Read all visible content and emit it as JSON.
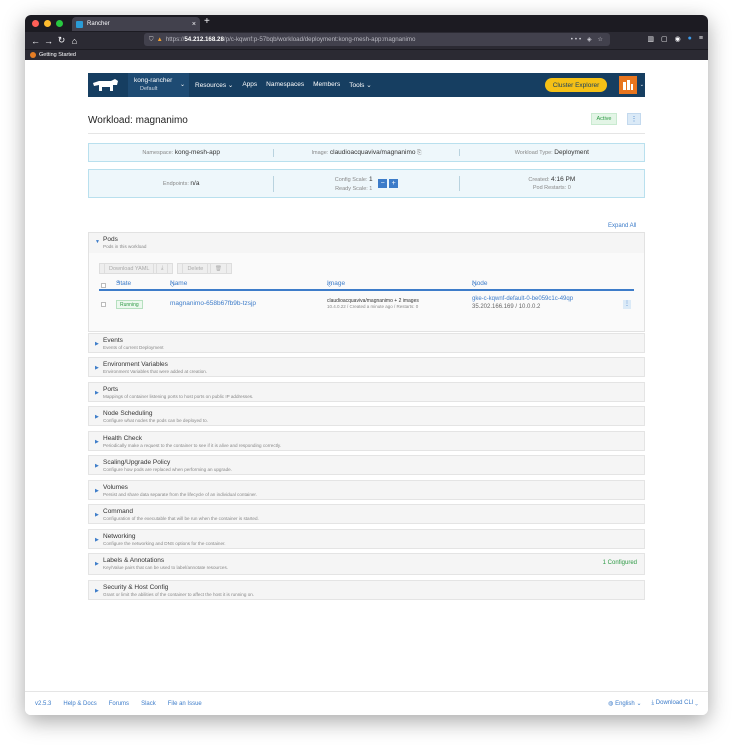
{
  "browser": {
    "tab_title": "Rancher",
    "tab_close": "×",
    "new_tab": "+",
    "url_host": "54.212.168.28",
    "url_prefix": "https://",
    "url_rest": "/p/c-kqwnf:p-57bqb/workload/deployment:kong-mesh-app:magnanimo",
    "bookmark": "Getting Started"
  },
  "header": {
    "cluster_name": "kong-rancher",
    "project_name": "Default",
    "menu": [
      "Resources",
      "Apps",
      "Namespaces",
      "Members",
      "Tools"
    ],
    "cluster_explorer": "Cluster Explorer"
  },
  "workload": {
    "title": "Workload: magnanimo",
    "status": "Active",
    "namespace_label": "Namespace:",
    "namespace": "kong-mesh-app",
    "image_label": "Image:",
    "image": "claudioacquaviva/magnanimo",
    "type_label": "Workload Type:",
    "type": "Deployment",
    "endpoints_label": "Endpoints:",
    "endpoints": "n/a",
    "config_scale_label": "Config Scale:",
    "config_scale": "1",
    "ready_scale_label": "Ready Scale: 1",
    "created_label": "Created:",
    "created": "4:16 PM",
    "pod_restarts": "Pod Restarts: 0"
  },
  "expand_all": "Expand All",
  "pods": {
    "title": "Pods",
    "desc": "Pods in this workload",
    "download_yaml": "Download YAML",
    "delete": "Delete",
    "col_state": "State",
    "col_name": "Name",
    "col_image": "Image",
    "col_node": "Node",
    "row": {
      "state": "Running",
      "name": "magnanimo-658b67fb9b-tzsjp",
      "image": "claudioacquaviva/magnanimo + 2 images",
      "image_sub": "10.4.0.22 / Created a minute ago / Restarts: 0",
      "node": "gke-c-kqwnf-default-0-be059c1c-49qp",
      "node_ips": "35.202.166.169  /  10.0.0.2"
    }
  },
  "sections": [
    {
      "title": "Events",
      "desc": "Events of current Deployment"
    },
    {
      "title": "Environment Variables",
      "desc": "Environment Variables that were added at creation."
    },
    {
      "title": "Ports",
      "desc": "Mappings of container listening ports to host ports on public IP addresses."
    },
    {
      "title": "Node Scheduling",
      "desc": "Configure what nodes the pods can be deployed to."
    },
    {
      "title": "Health Check",
      "desc": "Periodically make a request to the container to see if it is alive and responding correctly."
    },
    {
      "title": "Scaling/Upgrade Policy",
      "desc": "Configure how pods are replaced when performing an upgrade."
    },
    {
      "title": "Volumes",
      "desc": "Persist and share data separate from the lifecycle of an individual container."
    },
    {
      "title": "Command",
      "desc": "Configuration of the executable that will be run when the container is started."
    },
    {
      "title": "Networking",
      "desc": "Configure the networking and DNS options for the container."
    },
    {
      "title": "Labels & Annotations",
      "desc": "Key/Value pairs that can be used to label/annotate resources.",
      "extra": "1 Configured"
    },
    {
      "title": "Security & Host Config",
      "desc": "Grant or limit the abilities of the container to affect the host it is running on."
    }
  ],
  "footer": {
    "version": "v2.5.3",
    "links": [
      "Help & Docs",
      "Forums",
      "Slack",
      "File an Issue"
    ],
    "language": "English",
    "download": "Download CLI"
  },
  "colors": {
    "nav": "#163e61",
    "accent": "#3d7cc9",
    "explorer": "#f5c116",
    "success": "#2e9a45"
  }
}
